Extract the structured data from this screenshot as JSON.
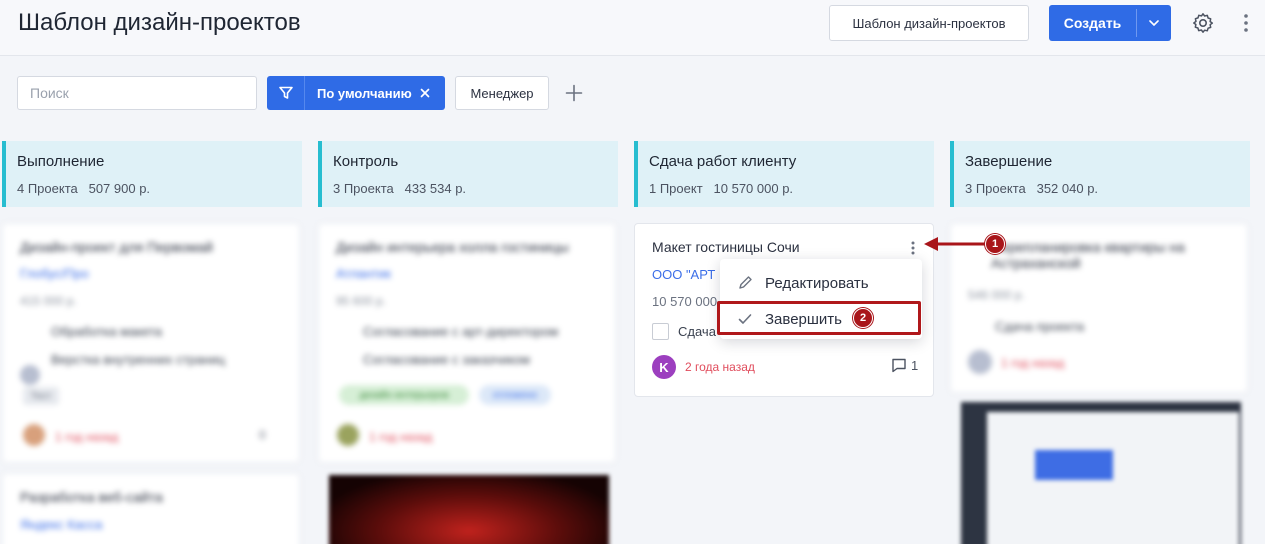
{
  "header": {
    "title": "Шаблон дизайн-проектов",
    "template_button": "Шаблон дизайн-проектов",
    "create_button": "Создать",
    "icons": [
      "gear-icon",
      "more-vertical-icon",
      "chevron-down-icon"
    ]
  },
  "toolbar": {
    "search_placeholder": "Поиск",
    "filter_label": "По умолчанию",
    "manager_label": "Менеджер",
    "icons": [
      "filter-icon",
      "close-icon",
      "plus-icon"
    ]
  },
  "columns": [
    {
      "name": "Выполнение",
      "count": "4 Проекта",
      "sum": "507 900 р."
    },
    {
      "name": "Контроль",
      "count": "3 Проекта",
      "sum": "433 534 р."
    },
    {
      "name": "Сдача работ клиенту",
      "count": "1 Проект",
      "sum": "10 570 000 р."
    },
    {
      "name": "Завершение",
      "count": "3 Проекта",
      "sum": "352 040 р."
    }
  ],
  "card": {
    "title": "Макет гостиницы Сочи",
    "company": "ООО \"АРТ",
    "amount": "10 570 000",
    "task": "Сдача",
    "avatar": "K",
    "date": "2 года назад",
    "comments": "1",
    "avatar_color": "#9c3fbf"
  },
  "menu": {
    "items": [
      {
        "label": "Редактировать",
        "icon": "pencil-icon"
      },
      {
        "label": "Завершить",
        "icon": "check-icon"
      }
    ]
  },
  "annotations": {
    "step1": "1",
    "step2": "2",
    "color": "#a9151a"
  },
  "blurred": {
    "col1_card1": {
      "title": "Дизайн-проект для Первомай",
      "link": "Глобус/Про",
      "amount": "415 000 р.",
      "tasks": [
        "Обработка макета",
        "Верстка внутренних страниц"
      ],
      "tag": "Тест",
      "date": "1 год назад",
      "comments": "0"
    },
    "col1_card2": {
      "title": "Разработка веб-сайта",
      "link": "Яндекс Касса"
    },
    "col2_card1": {
      "title": "Дизайн интерьера холла гостиницы",
      "link": "Атлантик",
      "amount": "95 600 р.",
      "tasks": [
        "Согласование с арт-директором",
        "Согласование с заказчиком"
      ],
      "tags": [
        "дизайн интерьеров",
        "отложено"
      ],
      "date": "1 год назад"
    },
    "col4_card1": {
      "title": "Перепланировка квартиры на Астраханской",
      "amount": "546 000 р.",
      "tasks": [
        "Сдача проекта"
      ],
      "date": "1 год назад"
    }
  }
}
